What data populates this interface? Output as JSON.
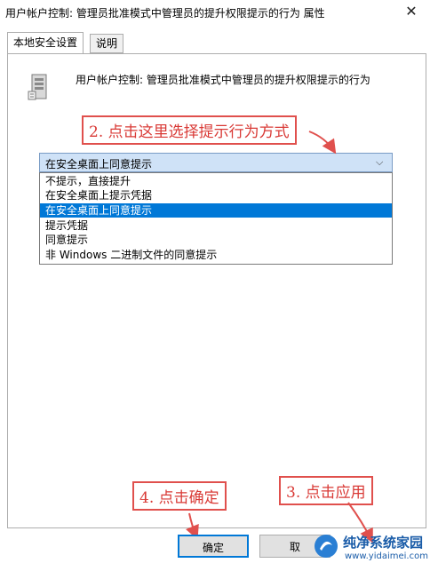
{
  "window": {
    "title": "用户帐户控制: 管理员批准模式中管理员的提升权限提示的行为 属性",
    "close_glyph": "✕"
  },
  "tabs": [
    {
      "label": "本地安全设置",
      "active": true
    },
    {
      "label": "说明",
      "active": false
    }
  ],
  "policy": {
    "icon": "server-icon",
    "name": "用户帐户控制: 管理员批准模式中管理员的提升权限提示的行为"
  },
  "combo": {
    "value": "在安全桌面上同意提示",
    "chevron_glyph": "⌵",
    "options": [
      {
        "label": "不提示，直接提升",
        "selected": false
      },
      {
        "label": "在安全桌面上提示凭据",
        "selected": false
      },
      {
        "label": "在安全桌面上同意提示",
        "selected": true
      },
      {
        "label": "提示凭据",
        "selected": false
      },
      {
        "label": "同意提示",
        "selected": false
      },
      {
        "label": "非 Windows 二进制文件的同意提示",
        "selected": false
      }
    ]
  },
  "annotations": {
    "step2": "2. 点击这里选择提示行为方式",
    "step4": "4. 点击确定",
    "step3": "3. 点击应用",
    "color": "#e0504d"
  },
  "buttons": {
    "ok": "确定",
    "cancel": "取"
  },
  "watermark": {
    "name": "纯净系统家园",
    "url": "www.yidaimei.com"
  },
  "colors": {
    "selection": "#0078d7",
    "combo_bg": "#cfe2f7"
  }
}
